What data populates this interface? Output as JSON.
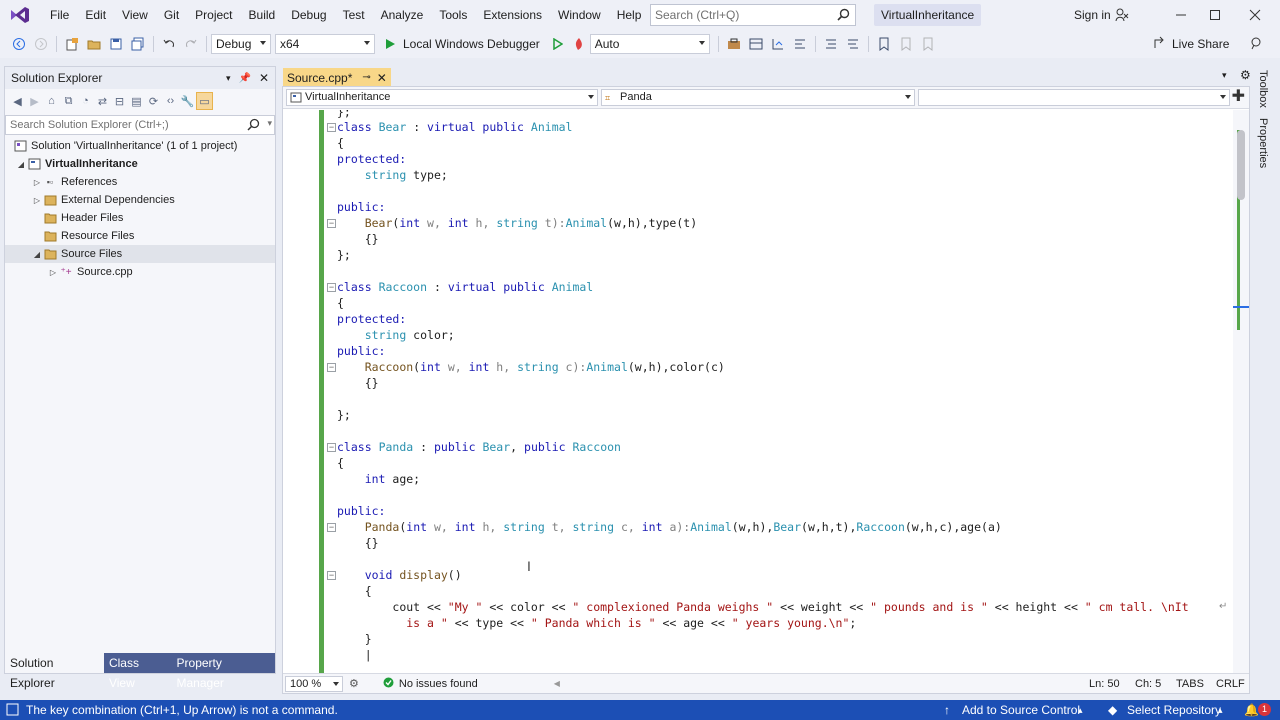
{
  "menubar": {
    "items": [
      "File",
      "Edit",
      "View",
      "Git",
      "Project",
      "Build",
      "Debug",
      "Test",
      "Analyze",
      "Tools",
      "Extensions",
      "Window",
      "Help"
    ],
    "search_placeholder": "Search (Ctrl+Q)",
    "solution_name": "VirtualInheritance",
    "sign_in": "Sign in"
  },
  "toolbar": {
    "config": "Debug",
    "platform": "x64",
    "debugger": "Local Windows Debugger",
    "auto": "Auto",
    "live_share": "Live Share"
  },
  "solution_explorer": {
    "title": "Solution Explorer",
    "search_placeholder": "Search Solution Explorer (Ctrl+;)",
    "solution": "Solution 'VirtualInheritance' (1 of 1 project)",
    "project": "VirtualInheritance",
    "nodes": {
      "references": "References",
      "external": "External Dependencies",
      "header": "Header Files",
      "resource": "Resource Files",
      "source": "Source Files",
      "source_cpp": "Source.cpp"
    },
    "tabs": [
      "Solution Explorer",
      "Class View",
      "Property Manager"
    ]
  },
  "editor": {
    "tab_label": "Source.cpp*",
    "nav_project": "VirtualInheritance",
    "nav_scope": "Panda",
    "nav_member": "",
    "zoom": "100 %",
    "issues": "No issues found",
    "line": "Ln: 50",
    "column": "Ch: 5",
    "tabs_mode": "TABS",
    "line_ending": "CRLF"
  },
  "code": {
    "l0": "};",
    "l1_c": "class",
    "l1_n": "Bear",
    "l1_m": " : ",
    "l1_v": "virtual public",
    "l1_b": "Animal",
    "l2": "{",
    "l3": "protected:",
    "l4_t": "string",
    "l4_r": " type;",
    "l6": "public:",
    "l7_f": "Bear",
    "l7_a": "(",
    "l7_i1": "int",
    "l7_p1": " w, ",
    "l7_i2": "int",
    "l7_p2": " h, ",
    "l7_s": "string",
    "l7_p3": " t):",
    "l7_an": "Animal",
    "l7_rest": "(w,h),type(t)",
    "l8": "{}",
    "l9": "};",
    "l11_c": "class",
    "l11_n": "Raccoon",
    "l11_m": " : ",
    "l11_v": "virtual public",
    "l11_b": "Animal",
    "l12": "{",
    "l13": "protected:",
    "l14_t": "string",
    "l14_r": " color;",
    "l15": "public:",
    "l16_f": "Raccoon",
    "l16_a": "(",
    "l16_i1": "int",
    "l16_p1": " w, ",
    "l16_i2": "int",
    "l16_p2": " h, ",
    "l16_s": "string",
    "l16_p3": " c):",
    "l16_an": "Animal",
    "l16_rest": "(w,h),color(c)",
    "l17": "{}",
    "l19": "};",
    "l21_c": "class",
    "l21_n": "Panda",
    "l21_m": " : ",
    "l21_p1": "public",
    "l21_b1": "Bear",
    "l21_comma": ", ",
    "l21_p2": "public",
    "l21_b2": "Raccoon",
    "l22": "{",
    "l23_t": "int",
    "l23_r": " age;",
    "l25": "public:",
    "l26_f": "Panda",
    "l26_a": "(",
    "l26_i1": "int",
    "l26_p1": " w, ",
    "l26_i2": "int",
    "l26_p2": " h, ",
    "l26_s1": "string",
    "l26_p3": " t, ",
    "l26_s2": "string",
    "l26_p4": " c, ",
    "l26_i3": "int",
    "l26_p5": " a):",
    "l26_an": "Animal",
    "l26_r1": "(w,h),",
    "l26_be": "Bear",
    "l26_r2": "(w,h,t),",
    "l26_ra": "Raccoon",
    "l26_r3": "(w,h,c),age(a)",
    "l27": "{}",
    "l29_v": "void",
    "l29_f": " display",
    "l29_r": "()",
    "l30": "{",
    "l31_a": "cout << ",
    "l31_s1": "\"My \"",
    "l31_b": " << color << ",
    "l31_s2": "\" complexioned Panda weighs \"",
    "l31_c": " << weight << ",
    "l31_s3": "\" pounds and is \"",
    "l31_d": " << height << ",
    "l31_s4": "\" cm tall. \\nIt",
    "l32_s1": "is a \"",
    "l32_a": " << type << ",
    "l32_s2": "\" Panda which is \"",
    "l32_b": " << age << ",
    "l32_s3": "\" years young.\\n\"",
    "l32_e": ";",
    "l33": "}",
    "l34": "|"
  },
  "right_rail": {
    "toolbox": "Toolbox",
    "properties": "Properties"
  },
  "statusbar": {
    "message": "The key combination (Ctrl+1, Up Arrow) is not a command.",
    "add_source": "Add to Source Control",
    "select_repo": "Select Repository",
    "notifications": "1"
  },
  "colors": {
    "accent": "#1c4fb5",
    "active_tab": "#f8d788",
    "keyword": "#1a1ab3",
    "type": "#2b91af",
    "string": "#a31515",
    "change_margin": "#57a64a"
  }
}
